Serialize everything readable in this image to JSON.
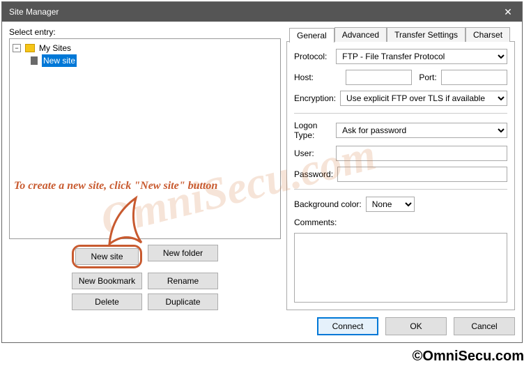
{
  "window": {
    "title": "Site Manager"
  },
  "left": {
    "label": "Select entry:",
    "tree": {
      "root_label": "My Sites",
      "item_label": "New site"
    },
    "buttons": {
      "new_site": "New site",
      "new_folder": "New folder",
      "new_bookmark": "New Bookmark",
      "rename": "Rename",
      "delete": "Delete",
      "duplicate": "Duplicate"
    }
  },
  "tabs": {
    "general": "General",
    "advanced": "Advanced",
    "transfer": "Transfer Settings",
    "charset": "Charset"
  },
  "form": {
    "protocol_label": "Protocol:",
    "protocol_value": "FTP - File Transfer Protocol",
    "host_label": "Host:",
    "host_value": "",
    "port_label": "Port:",
    "port_value": "",
    "encryption_label": "Encryption:",
    "encryption_value": "Use explicit FTP over TLS if available",
    "logon_label": "Logon Type:",
    "logon_value": "Ask for password",
    "user_label": "User:",
    "user_value": "",
    "password_label": "Password:",
    "password_value": "",
    "bgcolor_label": "Background color:",
    "bgcolor_value": "None",
    "comments_label": "Comments:",
    "comments_value": ""
  },
  "footer": {
    "connect": "Connect",
    "ok": "OK",
    "cancel": "Cancel"
  },
  "annotation": {
    "text": "To create a new site, click  \"New site\" button"
  },
  "watermark": "OmniSecu.com",
  "copyright": "©OmniSecu.com"
}
